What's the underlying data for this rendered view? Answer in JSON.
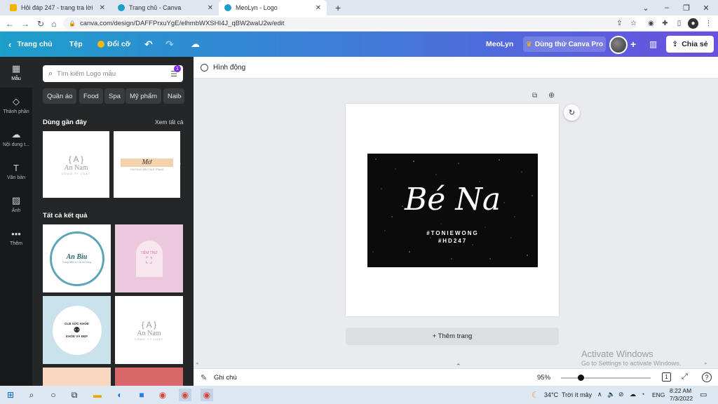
{
  "browser": {
    "tabs": [
      {
        "title": "Hỏi đáp 247 - trang tra lời",
        "active": false
      },
      {
        "title": "Trang chủ - Canva",
        "active": false
      },
      {
        "title": "MeoLyn - Logo",
        "active": true
      }
    ],
    "new_tab": "+",
    "url": "canva.com/design/DAFFPrxuYgE/elhmbWXSHI4J_qBW2waU2w/edit"
  },
  "canva": {
    "home": "Trang chủ",
    "file": "Tệp",
    "resize": "Đổi cỡ",
    "design_name": "MeoLyn",
    "try_pro": "Dùng thử Canva Pro",
    "share": "Chia sẻ"
  },
  "rail": [
    {
      "label": "Mẫu",
      "icon": "template-icon"
    },
    {
      "label": "Thành phần",
      "icon": "elements-icon"
    },
    {
      "label": "Nội dung t...",
      "icon": "upload-icon"
    },
    {
      "label": "Văn bản",
      "icon": "text-icon"
    },
    {
      "label": "Ảnh",
      "icon": "photo-icon"
    },
    {
      "label": "Thêm",
      "icon": "more-icon"
    }
  ],
  "panel": {
    "search_placeholder": "Tìm kiếm Logo mẫu",
    "filter_count": "1",
    "chips": [
      "Quần áo",
      "Food",
      "Spa",
      "Mỹ phẩm",
      "Nail"
    ],
    "recent_title": "Dùng gần đây",
    "see_all": "Xem tất cả",
    "recent": [
      {
        "name": "An Nam",
        "sub": "CÔNG TY LUẬT"
      },
      {
        "name": "Mơ",
        "sub": "THƯƠNG HIỆU THỜI TRANG"
      }
    ],
    "all_title": "Tất cả kết quả",
    "results": [
      {
        "name": "An Bìu",
        "sub": "Trang điểm & Cắt tỉa móng"
      },
      {
        "name": "TIỆM TÍNZ",
        "sub": ""
      },
      {
        "name": "CLB SỨC KHỎE",
        "sub": "KHỎE VÀ ĐẸP"
      },
      {
        "name": "An Nam",
        "sub": "CÔNG TY LUẬT"
      }
    ]
  },
  "editor": {
    "animate": "Hình động",
    "design_title": "Bé Na",
    "design_sub1": "#TONIEWONG",
    "design_sub2": "#HD247",
    "add_page": "+ Thêm trang",
    "notes": "Ghi chú",
    "zoom": "95%",
    "zoom_fraction": 0.22,
    "page_num": "1",
    "watermark_title": "Activate Windows",
    "watermark_sub": "Go to Settings to activate Windows."
  },
  "taskbar": {
    "weather": "34°C",
    "weather_text": "Trời ít mây",
    "lang": "ENG",
    "time": "8:22 AM",
    "date": "7/3/2022"
  }
}
